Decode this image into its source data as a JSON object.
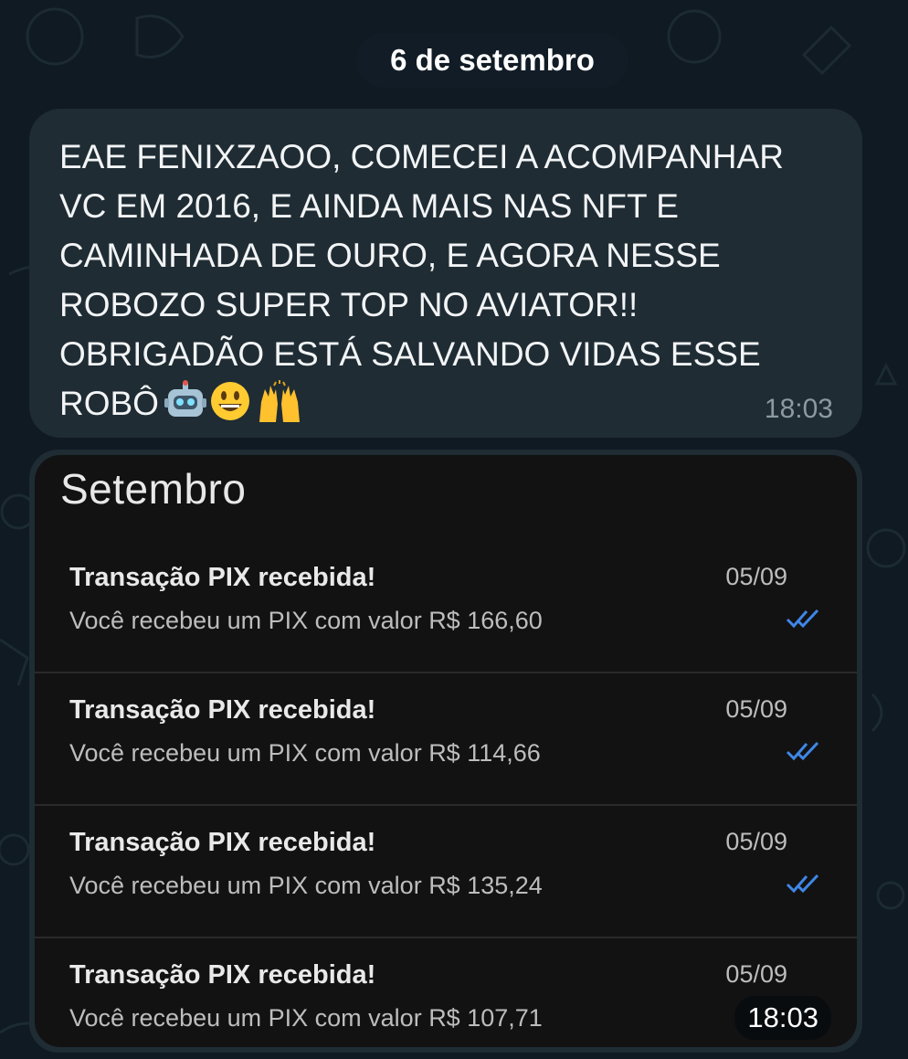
{
  "date_separator": "6 de setembro",
  "message": {
    "text": "EAE FENIXZAOO, COMECEI A ACOMPANHAR VC EM 2016, E AINDA MAIS NAS NFT E CAMINHADA DE OURO, E AGORA NESSE ROBOZO SUPER TOP NO AVIATOR!! OBRIGADÃO ESTÁ SALVANDO VIDAS ESSE ROBÔ",
    "emojis": [
      "robot-emoji",
      "grinning-face-emoji",
      "raising-hands-emoji"
    ],
    "time": "18:03"
  },
  "image_message": {
    "time": "18:03",
    "screenshot": {
      "title": "Setembro",
      "transactions": [
        {
          "title": "Transação PIX recebida!",
          "date": "05/09",
          "description": "Você recebeu um PIX com valor R$ 166,60"
        },
        {
          "title": "Transação PIX recebida!",
          "date": "05/09",
          "description": "Você recebeu um PIX com valor R$ 114,66"
        },
        {
          "title": "Transação PIX recebida!",
          "date": "05/09",
          "description": "Você recebeu um PIX com valor R$ 135,24"
        },
        {
          "title": "Transação PIX recebida!",
          "date": "05/09",
          "description": "Você recebeu um PIX com valor R$ 107,71"
        }
      ]
    }
  },
  "colors": {
    "chat_background": "#0f1a22",
    "incoming_bubble": "#1f2c34",
    "read_check": "#3f86e6"
  }
}
